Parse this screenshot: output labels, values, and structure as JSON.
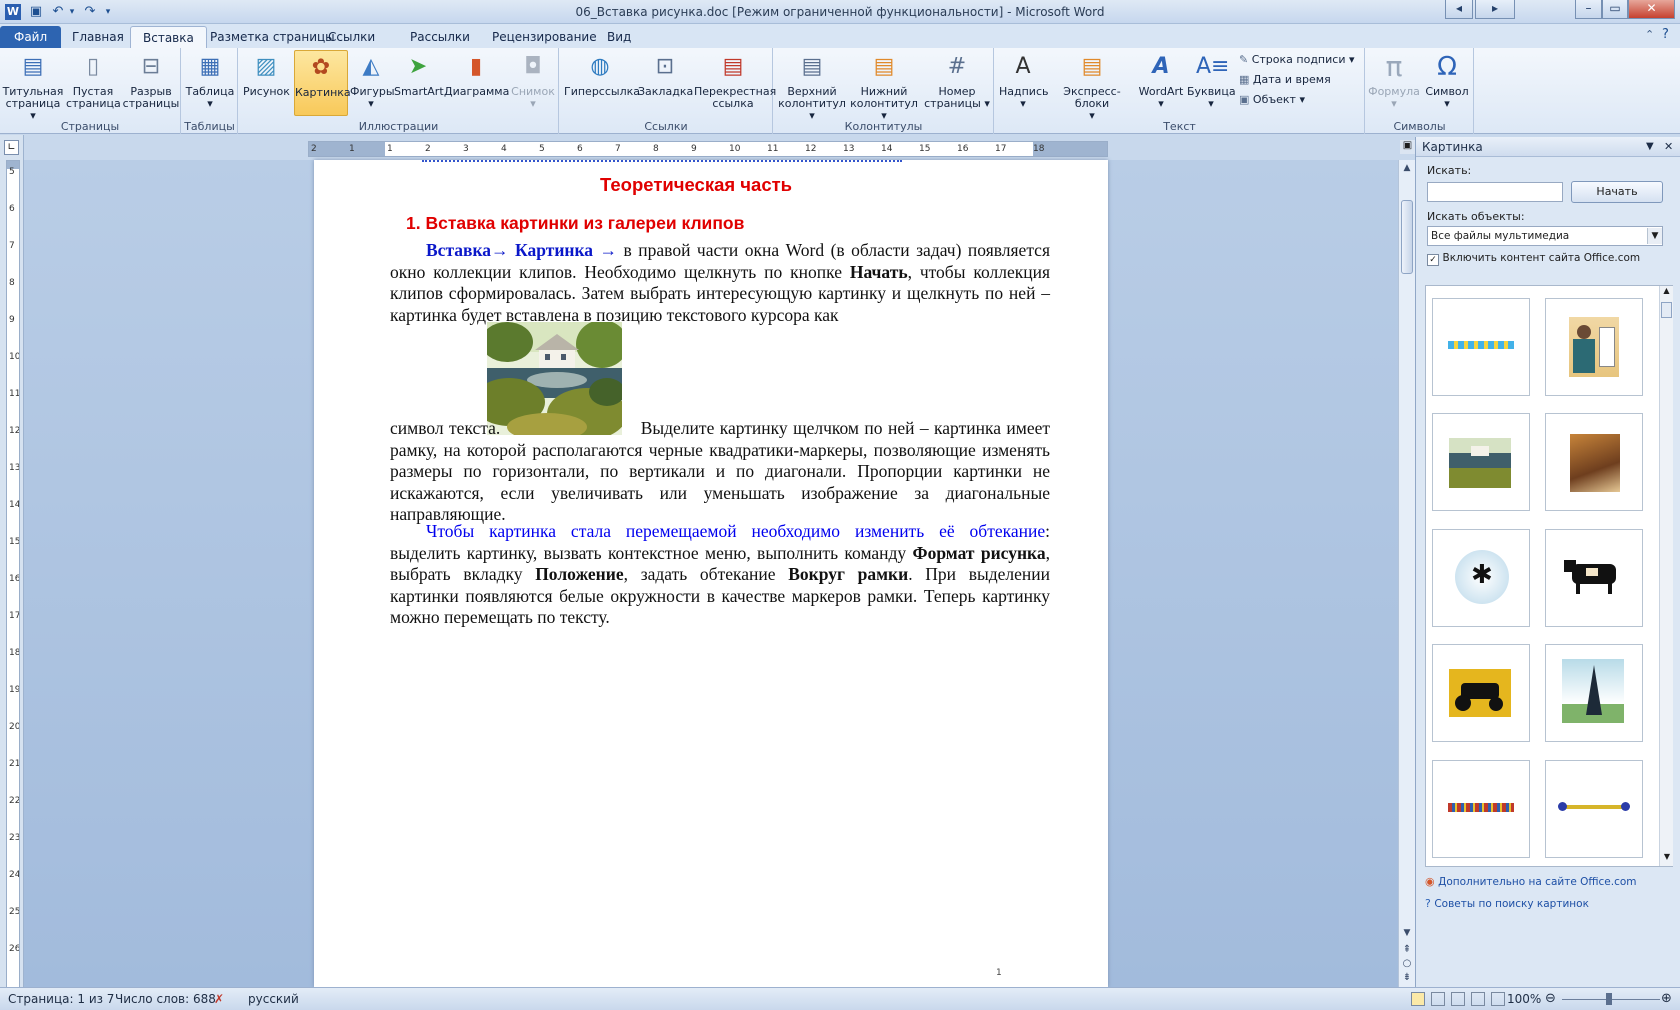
{
  "app": {
    "window_title": "06_Вставка рисунка.doc [Режим ограниченной функциональности] - Microsoft Word"
  },
  "tabs": [
    "Файл",
    "Главная",
    "Вставка",
    "Разметка страницы",
    "Ссылки",
    "Рассылки",
    "Рецензирование",
    "Вид"
  ],
  "active_tab": "Вставка",
  "ribbon": {
    "groups": {
      "pages": "Страницы",
      "tables": "Таблицы",
      "illustrations": "Иллюстрации",
      "links": "Ссылки",
      "headers": "Колонтитулы",
      "text": "Текст",
      "symbols": "Символы"
    },
    "buttons": {
      "cover_page_1": "Титульная",
      "cover_page_2": "страница",
      "blank_page_1": "Пустая",
      "blank_page_2": "страница",
      "page_break_1": "Разрыв",
      "page_break_2": "страницы",
      "table": "Таблица",
      "picture": "Рисунок",
      "clip_art": "Картинка",
      "shapes": "Фигуры",
      "smartart": "SmartArt",
      "chart": "Диаграмма",
      "screenshot": "Снимок",
      "hyperlink": "Гиперссылка",
      "bookmark": "Закладка",
      "cross_ref_1": "Перекрестная",
      "cross_ref_2": "ссылка",
      "header_1": "Верхний",
      "header_2": "колонтитул",
      "footer_1": "Нижний",
      "footer_2": "колонтитул",
      "page_number_1": "Номер",
      "page_number_2": "страницы",
      "text_box": "Надпись",
      "quick_parts": "Экспресс-блоки",
      "wordart": "WordArt",
      "drop_cap": "Буквица",
      "signature_line": "Строка подписи",
      "date_time": "Дата и время",
      "object": "Объект",
      "equation": "Формула",
      "symbol": "Символ"
    }
  },
  "document": {
    "heading_main": "Теоретическая часть",
    "heading_sub": "1. Вставка картинки из галереи клипов",
    "p1_lead": "Вставка→ Картинка →",
    "p1_rest": " в правой части окна Word (в области задач) появляется окно коллекции клипов. Необходимо щелкнуть по кнопке ",
    "p1_button": "Начать",
    "p1_tail": ", чтобы коллекция клипов сформировалась. Затем выбрать интересующую картинку и щелкнуть по ней – картинка будет вставлена в позицию текстового курсора как",
    "p2_start": "символ текста.",
    "p2_rest": " Выделите картинку щелчком по ней –  картинка имеет рамку, на которой располагаются черные квадратики-маркеры, позволяющие изменять размеры по горизонтали, по вертикали и по диагонали. Пропорции картинки не искажаются, если увеличивать или уменьшать изображение за диагональные направляющие.",
    "p3_blue": "Чтобы картинка стала перемещаемой необходимо изменить её обтекание",
    "p3_a": ": выделить картинку, вызвать контекстное меню, выполнить команду ",
    "p3_b1": "Формат рисунка",
    "p3_c": ", выбрать вкладку ",
    "p3_b2": "Положение",
    "p3_d": ", задать обтекание ",
    "p3_b3": "Вокруг рамки",
    "p3_e": ". При выделении картинки появляются белые окружности в качестве маркеров рамки. Теперь картинку можно перемещать по тексту.",
    "page_num": "1"
  },
  "clipart_pane": {
    "title": "Картинка",
    "search_label": "Искать:",
    "search_value": "",
    "go_button": "Начать",
    "results_label": "Искать объекты:",
    "results_value": "Все файлы мультимедиа",
    "include_office": "Включить контент сайта Office.com",
    "include_office_checked": true,
    "link_more": "Дополнительно на сайте Office.com",
    "link_tips": "Советы по поиску картинок"
  },
  "status_bar": {
    "page": "Страница: 1 из 7",
    "words": "Число слов: 688",
    "language": "русский",
    "zoom": "100%"
  },
  "hruler_ticks": [
    "2",
    "1",
    "1",
    "2",
    "3",
    "4",
    "5",
    "6",
    "7",
    "8",
    "9",
    "10",
    "11",
    "12",
    "13",
    "14",
    "15",
    "16",
    "17",
    "18"
  ],
  "vruler_ticks": [
    "5",
    "6",
    "7",
    "8",
    "9",
    "10",
    "11",
    "12",
    "13",
    "14",
    "15",
    "16",
    "17",
    "18",
    "19",
    "20",
    "21",
    "22",
    "23",
    "24",
    "25",
    "26"
  ],
  "colors": {
    "accent": "#2d64b1",
    "heading_red": "#e00000",
    "link_blue": "#0000ee"
  }
}
